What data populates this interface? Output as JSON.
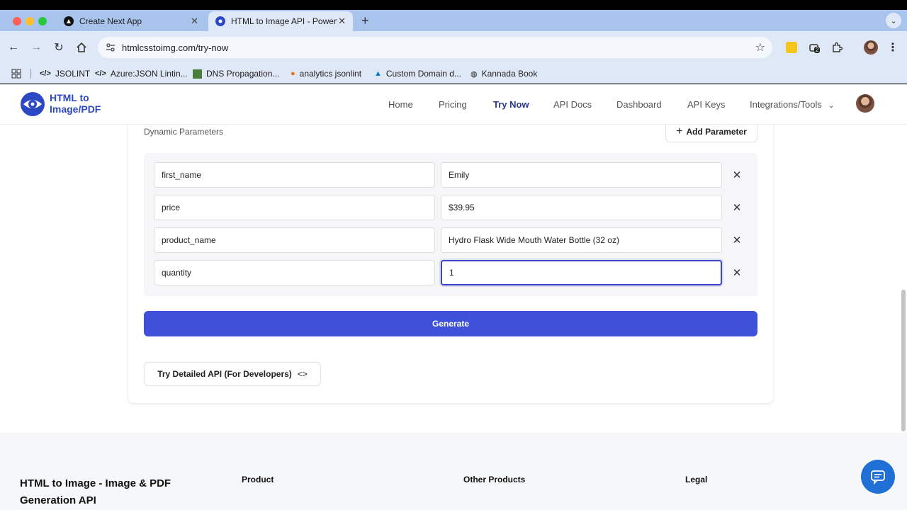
{
  "browser": {
    "tabs": [
      {
        "label": "Create Next App",
        "active": false
      },
      {
        "label": "HTML to Image API - Powerfu",
        "active": true
      }
    ],
    "url": "htmlcsstoimg.com/try-now",
    "extension_badge": "2",
    "bookmarks": [
      {
        "label": "JSOLINT",
        "icon": "code-icon"
      },
      {
        "label": "Azure:JSON Lintin...",
        "icon": "code-icon"
      },
      {
        "label": "DNS Propagation...",
        "icon": "dns-icon"
      },
      {
        "label": "analytics jsonlint",
        "icon": "analytics-icon"
      },
      {
        "label": "Custom Domain d...",
        "icon": "azure-icon"
      },
      {
        "label": "Kannada Book",
        "icon": "globe-icon"
      }
    ]
  },
  "site": {
    "logo_line1": "HTML to",
    "logo_line2": "Image/PDF",
    "nav": [
      {
        "label": "Home",
        "active": false
      },
      {
        "label": "Pricing",
        "active": false
      },
      {
        "label": "Try Now",
        "active": true
      },
      {
        "label": "API Docs",
        "active": false
      },
      {
        "label": "Dashboard",
        "active": false
      },
      {
        "label": "API Keys",
        "active": false
      },
      {
        "label": "Integrations/Tools",
        "active": false
      }
    ]
  },
  "form": {
    "section_label": "Dynamic Parameters",
    "add_button": "Add Parameter",
    "parameters": [
      {
        "key": "first_name",
        "value": "Emily"
      },
      {
        "key": "price",
        "value": "$39.95"
      },
      {
        "key": "product_name",
        "value": "Hydro Flask Wide Mouth Water Bottle (32 oz)"
      },
      {
        "key": "quantity",
        "value": "1"
      }
    ],
    "generate_button": "Generate",
    "detailed_button": "Try Detailed API (For Developers)"
  },
  "footer": {
    "brand": "HTML to Image - Image & PDF Generation API",
    "columns": [
      "Product",
      "Other Products",
      "Legal"
    ]
  },
  "colors": {
    "accent": "#3f51d9",
    "brand": "#2d48c5",
    "chat": "#1f6fd6"
  }
}
